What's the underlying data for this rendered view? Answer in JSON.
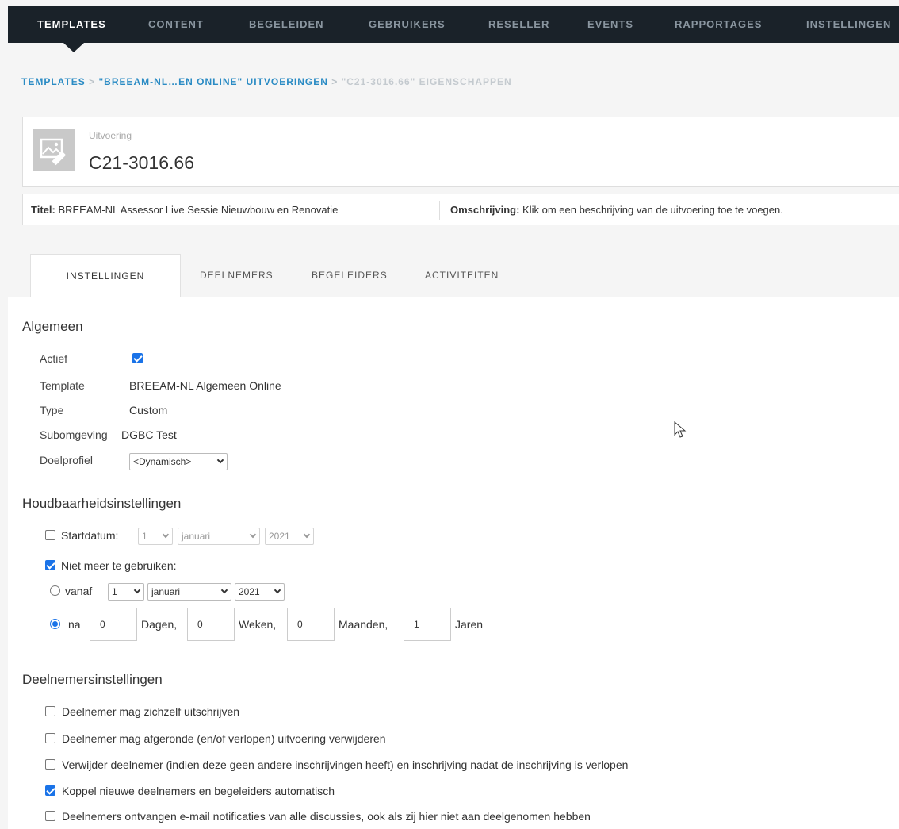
{
  "nav": {
    "items": [
      "TEMPLATES",
      "CONTENT",
      "BEGELEIDEN",
      "GEBRUIKERS",
      "RESELLER",
      "EVENTS",
      "RAPPORTAGES",
      "INSTELLINGEN"
    ],
    "active": "TEMPLATES"
  },
  "breadcrumb": {
    "items": [
      "TEMPLATES",
      "\"BREEAM-NL…EN ONLINE\" UITVOERINGEN",
      "\"C21-3016.66\" EIGENSCHAPPEN"
    ],
    "separator": ">"
  },
  "header": {
    "subtitle": "Uitvoering",
    "title": "C21-3016.66",
    "titel_label": "Titel:",
    "titel_value": "BREEAM-NL Assessor Live Sessie Nieuwbouw en Renovatie",
    "omschrijving_label": "Omschrijving:",
    "omschrijving_value": "Klik om een beschrijving van de uitvoering toe te voegen."
  },
  "tabs": [
    "INSTELLINGEN",
    "DEELNEMERS",
    "BEGELEIDERS",
    "ACTIVITEITEN"
  ],
  "algemeen": {
    "title": "Algemeen",
    "actief_label": "Actief",
    "actief_checked": true,
    "template_label": "Template",
    "template_value": "BREEAM-NL Algemeen Online",
    "type_label": "Type",
    "type_value": "Custom",
    "subomgeving_label": "Subomgeving",
    "subomgeving_value": "DGBC Test",
    "doelprofiel_label": "Doelprofiel",
    "doelprofiel_value": "<Dynamisch>"
  },
  "houdbaarheid": {
    "title": "Houdbaarheidsinstellingen",
    "startdatum_label": "Startdatum:",
    "startdatum_checked": false,
    "start_day": "1",
    "start_month": "januari",
    "start_year": "2021",
    "niet_meer_label": "Niet meer te gebruiken:",
    "niet_meer_checked": true,
    "vanaf_label": "vanaf",
    "vanaf_selected": false,
    "vanaf_day": "1",
    "vanaf_month": "januari",
    "vanaf_year": "2021",
    "na_label": "na",
    "na_selected": true,
    "dagen_value": "0",
    "dagen_label": "Dagen,",
    "weken_value": "0",
    "weken_label": "Weken,",
    "maanden_value": "0",
    "maanden_label": "Maanden,",
    "jaren_value": "1",
    "jaren_label": "Jaren"
  },
  "deelnemers": {
    "title": "Deelnemersinstellingen",
    "options": [
      {
        "label": "Deelnemer mag zichzelf uitschrijven",
        "checked": false
      },
      {
        "label": "Deelnemer mag afgeronde (en/of verlopen) uitvoering verwijderen",
        "checked": false
      },
      {
        "label": "Verwijder deelnemer (indien deze geen andere inschrijvingen heeft) en inschrijving nadat de inschrijving is verlopen",
        "checked": false
      },
      {
        "label": "Koppel nieuwe deelnemers en begeleiders automatisch",
        "checked": true
      },
      {
        "label": "Deelnemers ontvangen e-mail notificaties van alle discussies, ook als zij hier niet aan deelgenomen hebben",
        "checked": false
      }
    ]
  }
}
